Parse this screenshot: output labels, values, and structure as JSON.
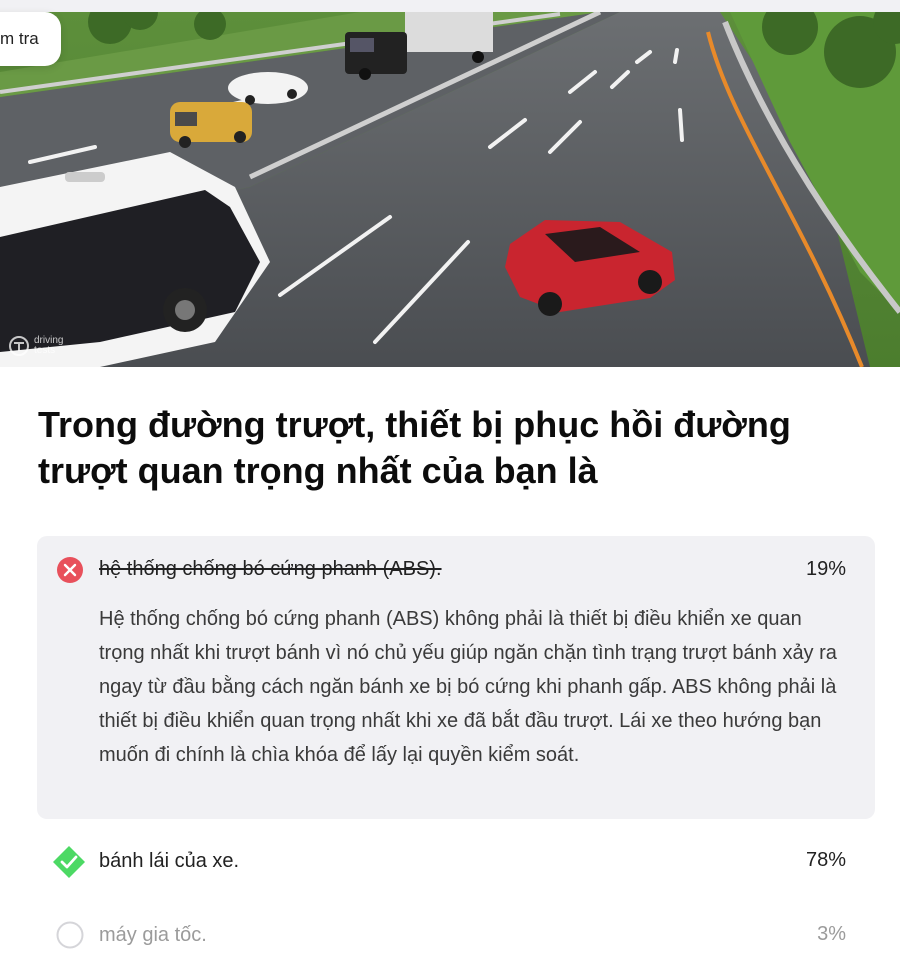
{
  "header": {
    "chip_label": "m tra"
  },
  "image": {
    "alt_icon": "road-scene-illustration",
    "watermark_lines": [
      "driving",
      "tests"
    ]
  },
  "question": {
    "text": "Trong đường trượt, thiết bị phục hồi đường trượt quan trọng nhất của bạn là"
  },
  "options": [
    {
      "label": "hệ thống chống bó cứng phanh (ABS).",
      "percent": "19%",
      "state": "wrong",
      "icon": "x-circle-icon",
      "explanation": "Hệ thống chống bó cứng phanh (ABS) không phải là thiết bị điều khiển xe quan trọng nhất khi trượt bánh vì nó chủ yếu giúp ngăn chặn tình trạng trượt bánh xảy ra ngay từ đầu bằng cách ngăn bánh xe bị bó cứng khi phanh gấp. ABS không phải là thiết bị điều khiển quan trọng nhất khi xe đã bắt đầu trượt. Lái xe theo hướng bạn muốn đi chính là chìa khóa để lấy lại quyền kiểm soát."
    },
    {
      "label": "bánh lái của xe.",
      "percent": "78%",
      "state": "correct",
      "icon": "check-diamond-icon"
    },
    {
      "label": "máy gia tốc.",
      "percent": "3%",
      "state": "neutral",
      "icon": "empty-circle-icon"
    }
  ],
  "colors": {
    "wrong": "#e8505b",
    "correct": "#4cd964",
    "answer_bg": "#f1f1f4"
  }
}
